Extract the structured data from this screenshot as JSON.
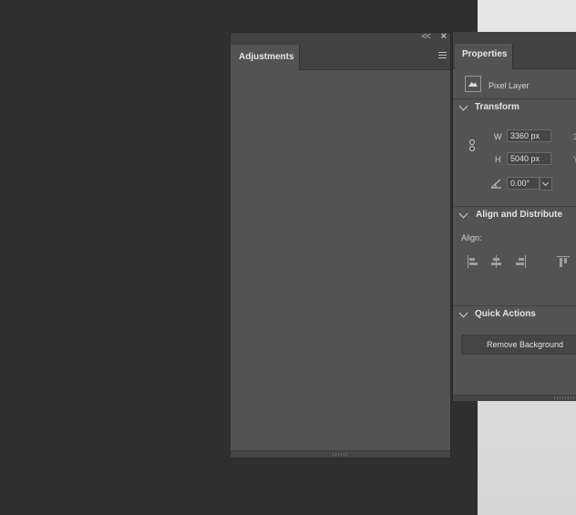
{
  "adjustments_panel": {
    "tab_label": "Adjustments",
    "collapse_icon": "double-chevron-left-icon",
    "close_icon": "close-icon",
    "menu_icon": "hamburger-menu-icon"
  },
  "properties_panel": {
    "tab_label": "Properties",
    "layer_type": "Pixel Layer",
    "layer_icon": "image-icon",
    "transform": {
      "title": "Transform",
      "w_label": "W",
      "w_value": "3360 px",
      "h_label": "H",
      "h_value": "5040 px",
      "angle_value": "0.00°",
      "link_icon": "chain-link-icon",
      "angle_icon": "angle-icon"
    },
    "align": {
      "title": "Align and Distribute",
      "label": "Align:",
      "icons": [
        "align-left-edges-icon",
        "align-horizontal-centers-icon",
        "align-right-edges-icon",
        "align-top-edges-icon"
      ]
    },
    "quick_actions": {
      "title": "Quick Actions",
      "remove_bg_label": "Remove Background"
    }
  },
  "colors": {
    "app_bg": "#2f2f2f",
    "panel_bg": "#535353",
    "panel_header": "#424242",
    "field_bg": "#454545",
    "text": "#e3e3e3"
  }
}
